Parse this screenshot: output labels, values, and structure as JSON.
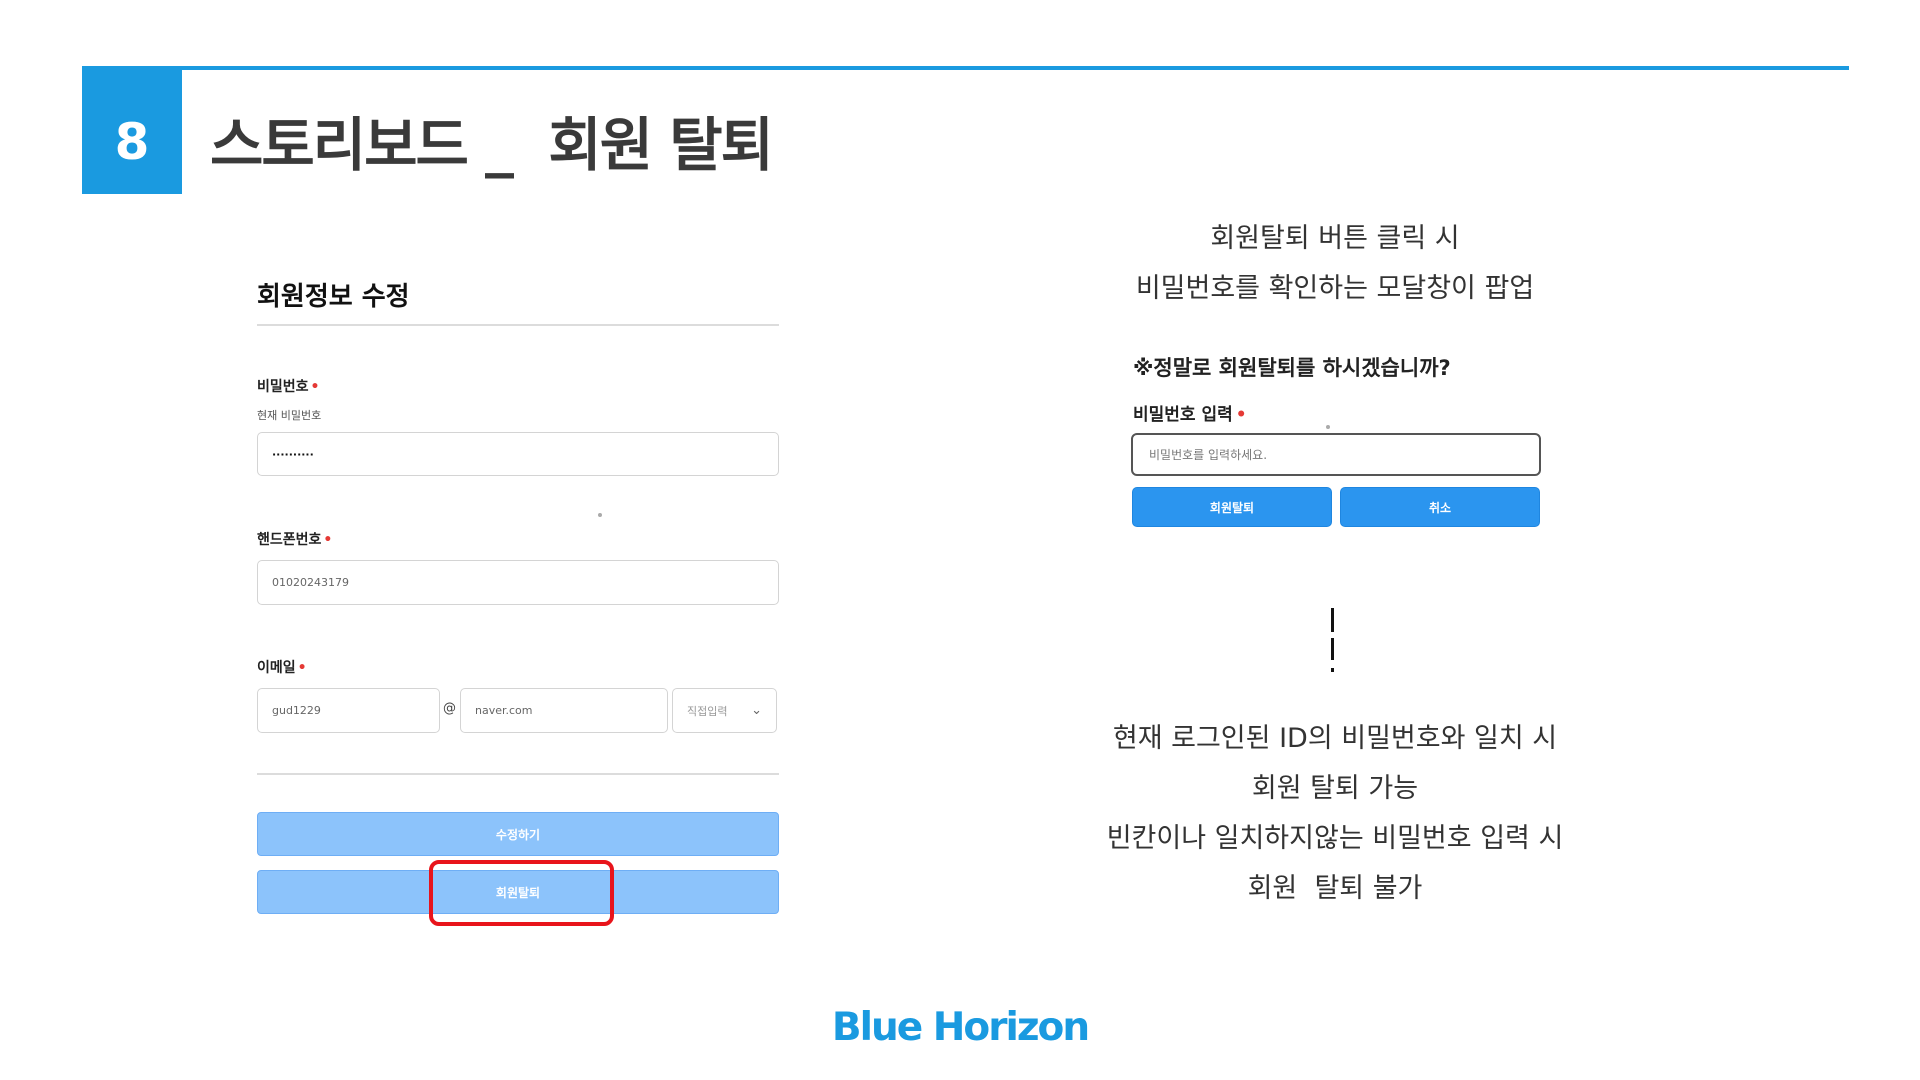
{
  "slide": {
    "number": "8",
    "title": "스토리보드 _  회원 탈퇴",
    "brand": "Blue Horizon",
    "accent_color": "#1a9ae0"
  },
  "form": {
    "title": "회원정보 수정",
    "password": {
      "label": "비밀번호",
      "required_mark": "•",
      "sublabel": "현재 비밀번호",
      "value": "··········"
    },
    "phone": {
      "label": "핸드폰번호",
      "required_mark": "•",
      "value": "01020243179"
    },
    "email": {
      "label": "이메일",
      "required_mark": "•",
      "local_value": "gud1229",
      "at": "@",
      "domain_value": "naver.com",
      "select_value": "직접입력"
    },
    "edit_button": "수정하기",
    "withdraw_button": "회원탈퇴",
    "highlight_color": "#e8141b"
  },
  "caption_top": {
    "line1": "회원탈퇴 버튼 클릭 시",
    "line2": "비밀번호를 확인하는 모달창이 팝업"
  },
  "modal": {
    "question": "※정말로 회원탈퇴를 하시겠습니까?",
    "label": "비밀번호 입력",
    "required_mark": "•",
    "placeholder": "비밀번호를 입력하세요.",
    "confirm_button": "회원탈퇴",
    "cancel_button": "취소",
    "button_color": "#2b95ef"
  },
  "caption_bottom": {
    "line1": "현재 로그인된 ID의 비밀번호와 일치 시",
    "line2": "회원 탈퇴 가능",
    "line3": "빈칸이나 일치하지않는 비밀번호 입력 시",
    "line4": "회원  탈퇴 불가"
  }
}
